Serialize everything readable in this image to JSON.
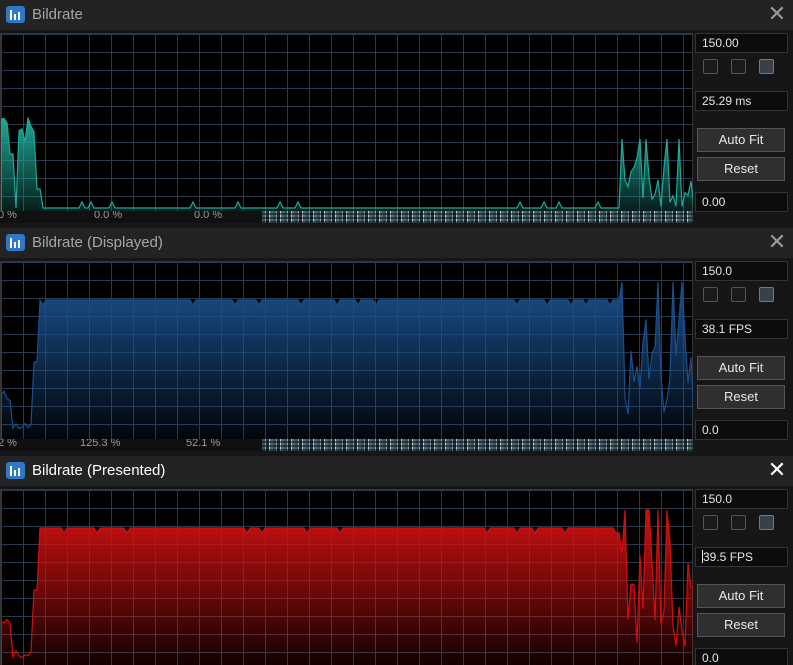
{
  "windows": [
    {
      "title": "Bildrate",
      "close_glyph": "✕",
      "active": false,
      "max_value": "150.00",
      "current_value": "25.29 ms",
      "min_value": "0.00",
      "auto_fit_label": "Auto Fit",
      "reset_label": "Reset",
      "status_percents": [
        "0 %",
        "0.0 %",
        "0.0 %"
      ],
      "checkboxes": [
        false,
        false,
        true
      ],
      "color": "#1fa898",
      "graph_icon": "bar-graph-icon"
    },
    {
      "title": "Bildrate (Displayed)",
      "close_glyph": "✕",
      "active": false,
      "max_value": "150.0",
      "current_value": "38.1 FPS",
      "min_value": "0.0",
      "auto_fit_label": "Auto Fit",
      "reset_label": "Reset",
      "status_percents": [
        "2 %",
        "125.3 %",
        "52.1 %"
      ],
      "checkboxes": [
        false,
        false,
        true
      ],
      "color": "#1a4f8c",
      "graph_icon": "bar-graph-icon"
    },
    {
      "title": "Bildrate (Presented)",
      "close_glyph": "✕",
      "active": true,
      "max_value": "150.0",
      "current_value": "39.5 FPS",
      "min_value": "0.0",
      "auto_fit_label": "Auto Fit",
      "reset_label": "Reset",
      "status_percents": [],
      "checkboxes": [
        false,
        false,
        true
      ],
      "color": "#d01010",
      "graph_icon": "bar-graph-icon"
    }
  ]
}
